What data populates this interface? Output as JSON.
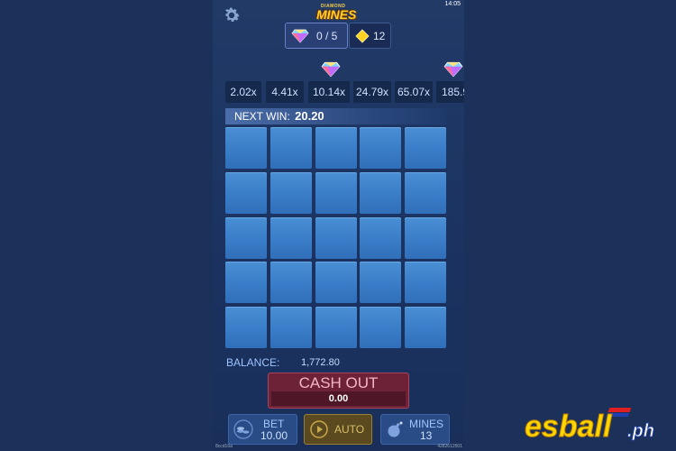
{
  "header": {
    "logo_top": "DIAMOND",
    "logo_main": "MINES",
    "clock": "14:05"
  },
  "counters": {
    "gems_found": "0 / 5",
    "mines_left": "12"
  },
  "multipliers": [
    "2.02x",
    "4.41x",
    "10.14x",
    "24.79x",
    "65.07x",
    "185.9"
  ],
  "next_win": {
    "label": "NEXT WIN:",
    "value": "20.20"
  },
  "grid": {
    "rows": 5,
    "cols": 5
  },
  "balance": {
    "label": "BALANCE:",
    "value": "1,772.80"
  },
  "cashout": {
    "label": "CASH OUT",
    "value": "0.00"
  },
  "controls": {
    "bet_label": "BET",
    "bet_value": "10.00",
    "auto_label": "AUTO",
    "mines_label": "MINES",
    "mines_value": "13"
  },
  "footer": {
    "left": "8ccd16a",
    "right": "4282612501"
  },
  "brand": {
    "text": "esball",
    "suffix": ".ph"
  },
  "colors": {
    "tile": "#3b7ec9",
    "background": "#1c3159",
    "cashout": "#6e2238",
    "accent_gold": "#ffcf2e"
  }
}
